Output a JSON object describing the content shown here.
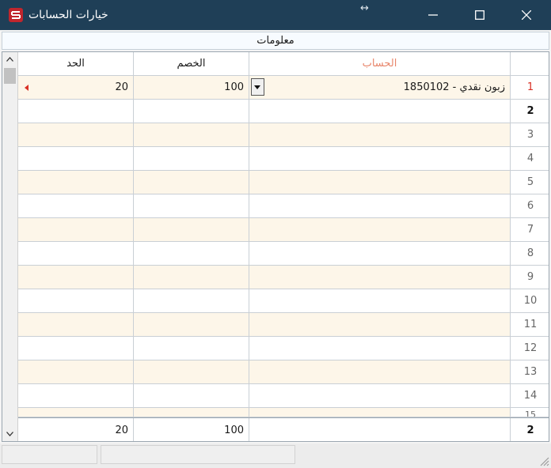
{
  "window": {
    "title": "خيارات الحسابات",
    "resize_glyph": "↔"
  },
  "info_bar": {
    "label": "معلومات"
  },
  "grid": {
    "columns": {
      "limit": "الحد",
      "discount": "الخصم",
      "account": "الحساب"
    },
    "rows": [
      {
        "num": "1",
        "account": "1850102 - زبون نقدي",
        "discount": "100",
        "limit": "20"
      },
      {
        "num": "2",
        "account": "",
        "discount": "",
        "limit": ""
      },
      {
        "num": "3",
        "account": "",
        "discount": "",
        "limit": ""
      },
      {
        "num": "4",
        "account": "",
        "discount": "",
        "limit": ""
      },
      {
        "num": "5",
        "account": "",
        "discount": "",
        "limit": ""
      },
      {
        "num": "6",
        "account": "",
        "discount": "",
        "limit": ""
      },
      {
        "num": "7",
        "account": "",
        "discount": "",
        "limit": ""
      },
      {
        "num": "8",
        "account": "",
        "discount": "",
        "limit": ""
      },
      {
        "num": "9",
        "account": "",
        "discount": "",
        "limit": ""
      },
      {
        "num": "10",
        "account": "",
        "discount": "",
        "limit": ""
      },
      {
        "num": "11",
        "account": "",
        "discount": "",
        "limit": ""
      },
      {
        "num": "12",
        "account": "",
        "discount": "",
        "limit": ""
      },
      {
        "num": "13",
        "account": "",
        "discount": "",
        "limit": ""
      },
      {
        "num": "14",
        "account": "",
        "discount": "",
        "limit": ""
      },
      {
        "num": "15",
        "account": "",
        "discount": "",
        "limit": ""
      }
    ],
    "footer": {
      "count": "2",
      "account": "",
      "discount": "100",
      "limit": "20"
    }
  },
  "colors": {
    "titlebar": "#1f3f57",
    "header_account": "#e8856a",
    "current_row_marker": "#d93025",
    "alt_row": "#fdf6e9"
  }
}
